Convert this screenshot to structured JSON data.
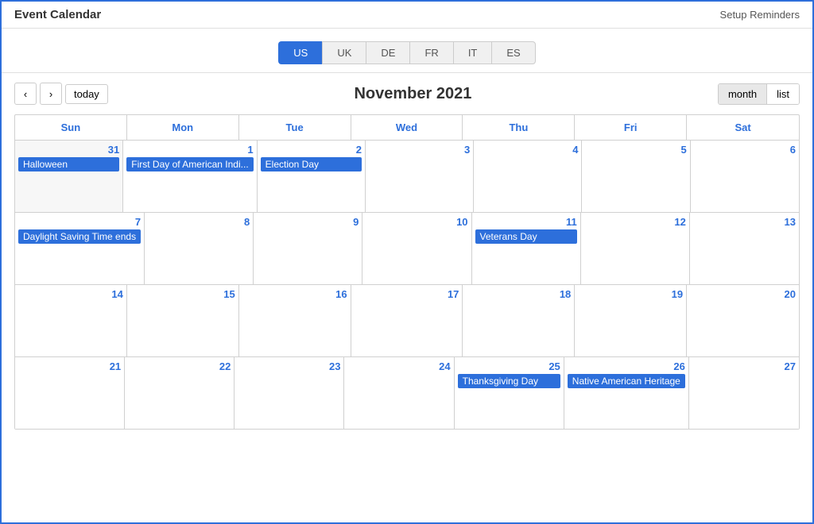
{
  "app": {
    "title": "Event Calendar",
    "setup_reminders": "Setup Reminders",
    "accent_color": "#2d6fdb"
  },
  "locale_tabs": {
    "tabs": [
      {
        "id": "US",
        "label": "US",
        "active": true
      },
      {
        "id": "UK",
        "label": "UK",
        "active": false
      },
      {
        "id": "DE",
        "label": "DE",
        "active": false
      },
      {
        "id": "FR",
        "label": "FR",
        "active": false
      },
      {
        "id": "IT",
        "label": "IT",
        "active": false
      },
      {
        "id": "ES",
        "label": "ES",
        "active": false
      }
    ]
  },
  "calendar": {
    "title": "November 2021",
    "today_label": "today",
    "view_month": "month",
    "view_list": "list",
    "day_headers": [
      "Sun",
      "Mon",
      "Tue",
      "Wed",
      "Thu",
      "Fri",
      "Sat"
    ],
    "weeks": [
      {
        "days": [
          {
            "number": "31",
            "out_of_month": true,
            "events": [
              "Halloween"
            ]
          },
          {
            "number": "1",
            "out_of_month": false,
            "events": [
              "First Day of American Indi..."
            ]
          },
          {
            "number": "2",
            "out_of_month": false,
            "events": [
              "Election Day"
            ]
          },
          {
            "number": "3",
            "out_of_month": false,
            "events": []
          },
          {
            "number": "4",
            "out_of_month": false,
            "events": []
          },
          {
            "number": "5",
            "out_of_month": false,
            "events": []
          },
          {
            "number": "6",
            "out_of_month": false,
            "events": []
          }
        ]
      },
      {
        "days": [
          {
            "number": "7",
            "out_of_month": false,
            "events": [
              "Daylight Saving Time ends"
            ]
          },
          {
            "number": "8",
            "out_of_month": false,
            "events": []
          },
          {
            "number": "9",
            "out_of_month": false,
            "events": []
          },
          {
            "number": "10",
            "out_of_month": false,
            "events": []
          },
          {
            "number": "11",
            "out_of_month": false,
            "events": [
              "Veterans Day"
            ]
          },
          {
            "number": "12",
            "out_of_month": false,
            "events": []
          },
          {
            "number": "13",
            "out_of_month": false,
            "events": []
          }
        ]
      },
      {
        "days": [
          {
            "number": "14",
            "out_of_month": false,
            "events": []
          },
          {
            "number": "15",
            "out_of_month": false,
            "events": []
          },
          {
            "number": "16",
            "out_of_month": false,
            "events": []
          },
          {
            "number": "17",
            "out_of_month": false,
            "events": []
          },
          {
            "number": "18",
            "out_of_month": false,
            "events": []
          },
          {
            "number": "19",
            "out_of_month": false,
            "events": []
          },
          {
            "number": "20",
            "out_of_month": false,
            "events": []
          }
        ]
      },
      {
        "days": [
          {
            "number": "21",
            "out_of_month": false,
            "events": []
          },
          {
            "number": "22",
            "out_of_month": false,
            "events": []
          },
          {
            "number": "23",
            "out_of_month": false,
            "events": []
          },
          {
            "number": "24",
            "out_of_month": false,
            "events": []
          },
          {
            "number": "25",
            "out_of_month": false,
            "events": [
              "Thanksgiving Day"
            ]
          },
          {
            "number": "26",
            "out_of_month": false,
            "events": [
              "Native American Heritage"
            ]
          },
          {
            "number": "27",
            "out_of_month": false,
            "events": []
          }
        ]
      }
    ]
  }
}
